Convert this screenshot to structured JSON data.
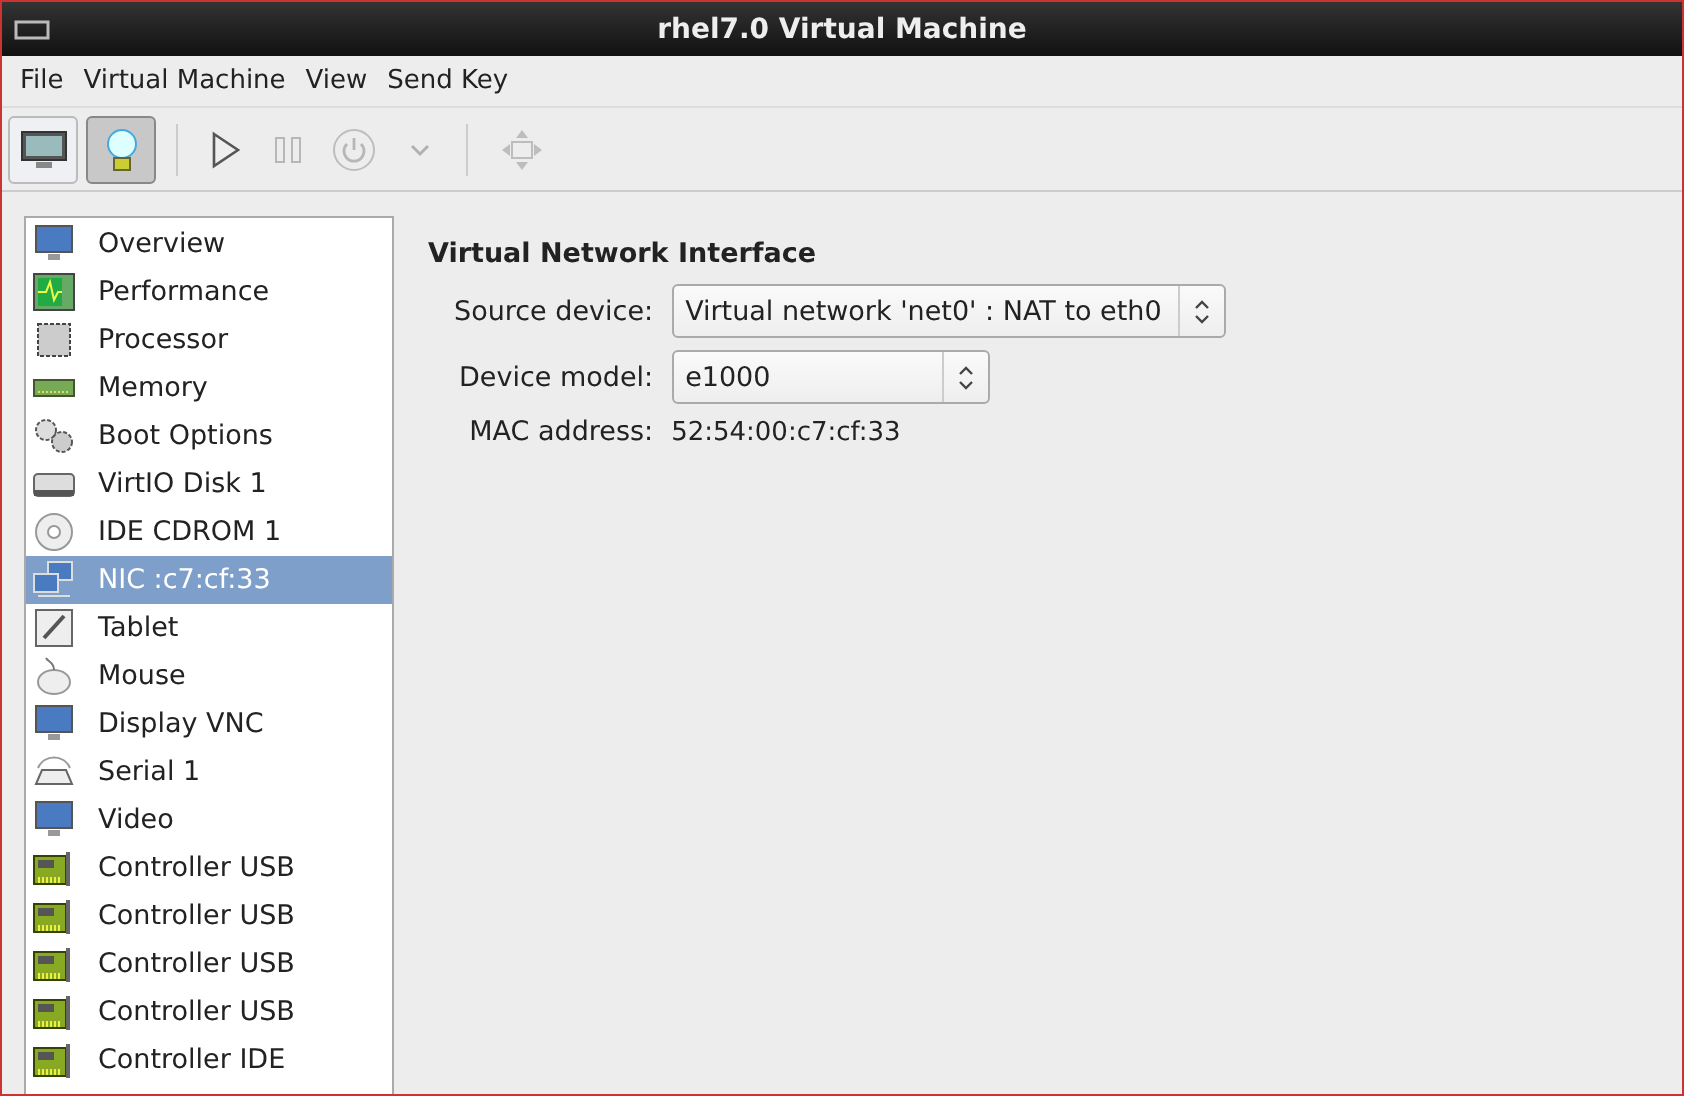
{
  "window": {
    "title": "rhel7.0 Virtual Machine"
  },
  "menu": [
    "File",
    "Virtual Machine",
    "View",
    "Send Key"
  ],
  "toolbar": {
    "views": [
      {
        "kind": "console",
        "selected": false
      },
      {
        "kind": "details",
        "selected": true
      }
    ],
    "actions": [
      {
        "kind": "run",
        "disabled": false
      },
      {
        "kind": "pause",
        "disabled": true
      },
      {
        "kind": "power",
        "disabled": true
      },
      {
        "kind": "dropdown",
        "disabled": true
      }
    ],
    "extra": [
      {
        "kind": "fullscreen",
        "disabled": true
      }
    ]
  },
  "sidebar": {
    "items": [
      {
        "label": "Overview",
        "kind": "monitor",
        "selected": false
      },
      {
        "label": "Performance",
        "kind": "chart",
        "selected": false
      },
      {
        "label": "Processor",
        "kind": "chip",
        "selected": false
      },
      {
        "label": "Memory",
        "kind": "ram",
        "selected": false
      },
      {
        "label": "Boot Options",
        "kind": "gears",
        "selected": false
      },
      {
        "label": "VirtIO Disk 1",
        "kind": "disk",
        "selected": false
      },
      {
        "label": "IDE CDROM 1",
        "kind": "cdrom",
        "selected": false
      },
      {
        "label": "NIC :c7:cf:33",
        "kind": "network",
        "selected": true
      },
      {
        "label": "Tablet",
        "kind": "tablet",
        "selected": false
      },
      {
        "label": "Mouse",
        "kind": "mouse",
        "selected": false
      },
      {
        "label": "Display VNC",
        "kind": "monitor",
        "selected": false
      },
      {
        "label": "Serial 1",
        "kind": "serial",
        "selected": false
      },
      {
        "label": "Video",
        "kind": "monitor",
        "selected": false
      },
      {
        "label": "Controller USB",
        "kind": "card",
        "selected": false
      },
      {
        "label": "Controller USB",
        "kind": "card",
        "selected": false
      },
      {
        "label": "Controller USB",
        "kind": "card",
        "selected": false
      },
      {
        "label": "Controller USB",
        "kind": "card",
        "selected": false
      },
      {
        "label": "Controller IDE",
        "kind": "card",
        "selected": false
      }
    ]
  },
  "details": {
    "heading": "Virtual Network Interface",
    "fields": [
      {
        "label": "Source device:",
        "value": "Virtual network 'net0' : NAT to eth0",
        "kind": "combo"
      },
      {
        "label": "Device model:",
        "value": "e1000",
        "kind": "combo"
      },
      {
        "label": "MAC address:",
        "value": "52:54:00:c7:cf:33",
        "kind": "text"
      }
    ]
  }
}
